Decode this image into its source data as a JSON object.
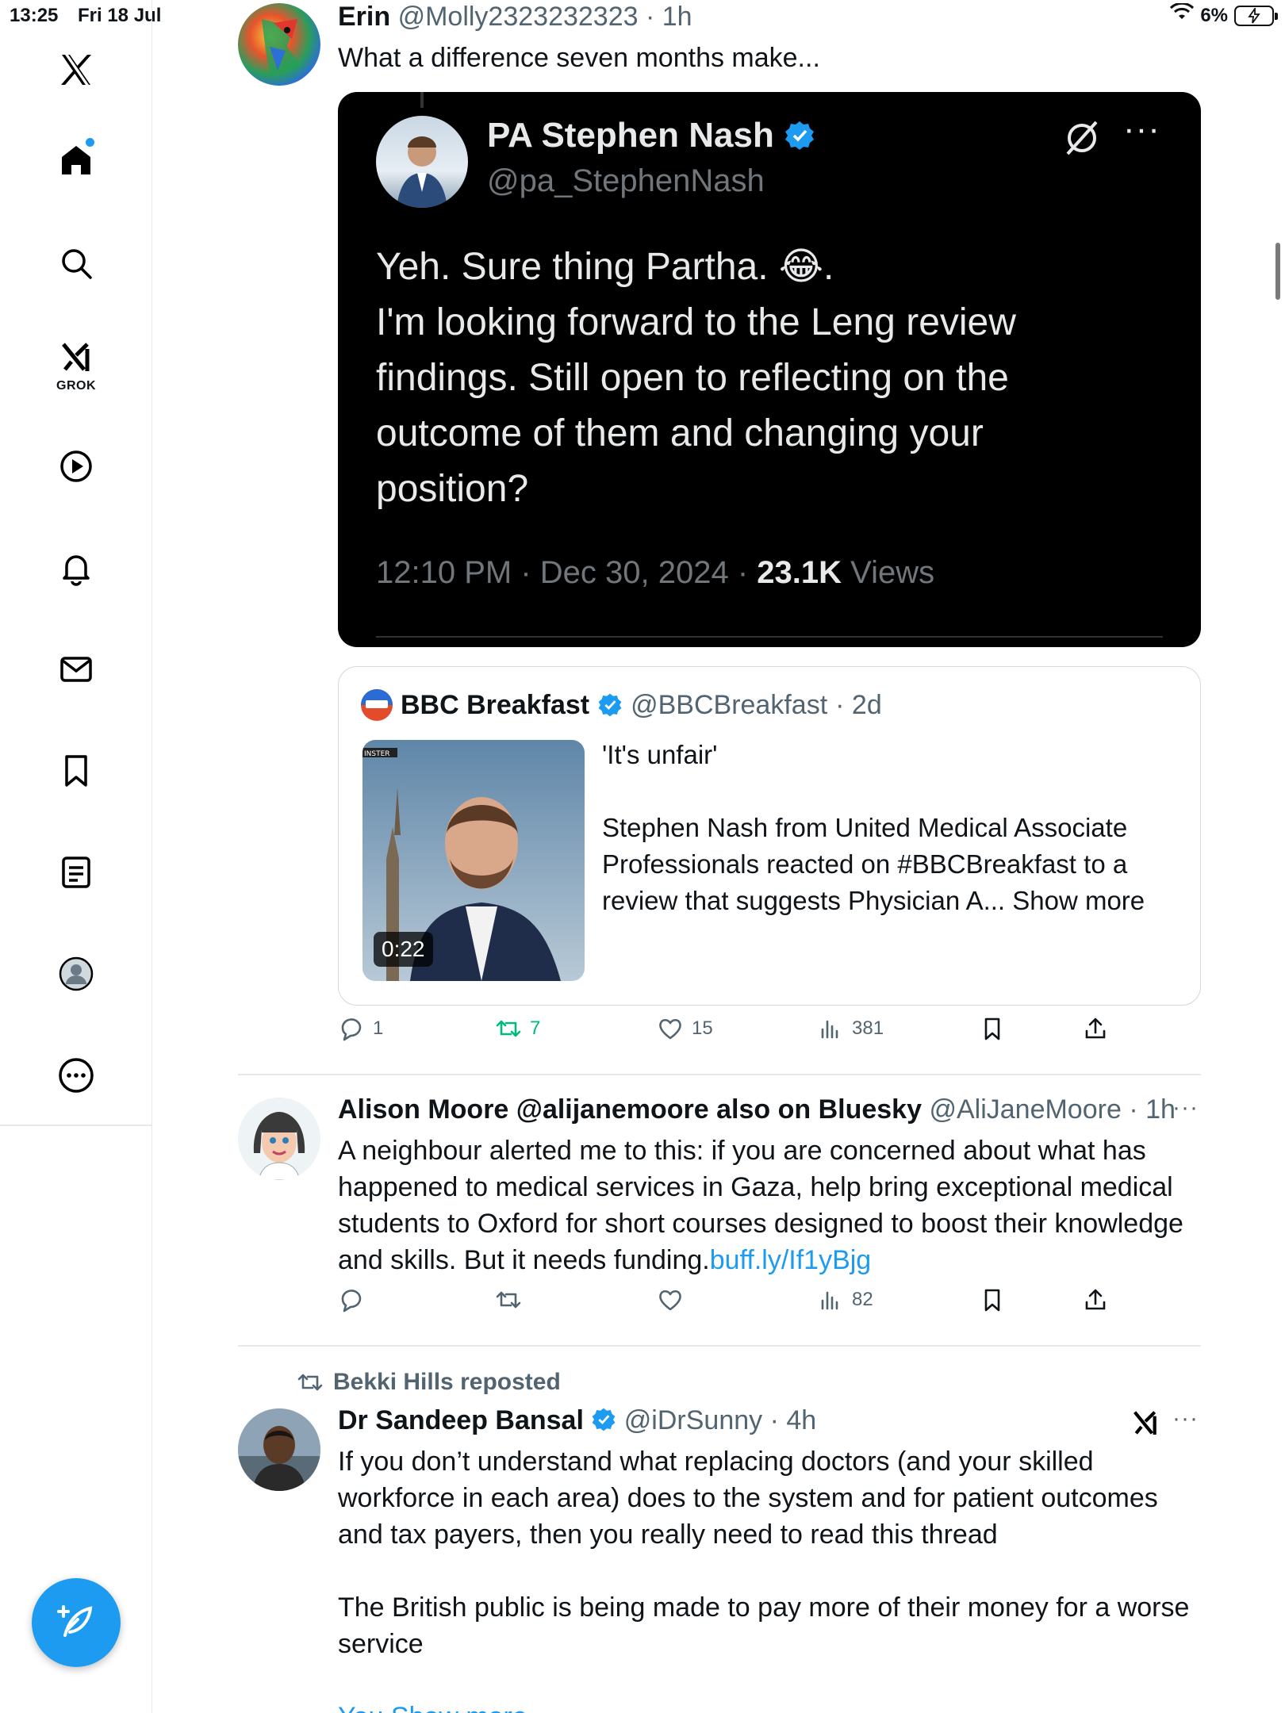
{
  "status_bar": {
    "time": "13:25",
    "date": "Fri 18 Jul",
    "battery": "6%"
  },
  "sidebar": {
    "items": [
      "home",
      "search",
      "grok",
      "video",
      "notifications",
      "messages",
      "bookmarks",
      "lists",
      "profile",
      "more"
    ],
    "grok_label": "GROK"
  },
  "tweet1": {
    "name": "Erin",
    "handle": "@Molly2323232323",
    "time": "1h",
    "text": "What a difference seven months make...",
    "embedded": {
      "name": "PA Stephen Nash",
      "handle": "@pa_StephenNash",
      "body_line1": "Yeh. Sure thing Partha. 😂.",
      "body_rest": "I'm looking forward to the Leng review findings. Still open to reflecting on the outcome of them and changing your position?",
      "timestamp": "12:10 PM · Dec 30, 2024 ·",
      "views_count": "23.1K",
      "views_label": "Views"
    },
    "quote": {
      "name": "BBC Breakfast",
      "handle": "@BBCBreakfast",
      "time": "· 2d",
      "line1": "'It's unfair'",
      "body": "Stephen Nash from United Medical Associate Professionals reacted on #BBCBreakfast to a review that suggests Physician A... Show more",
      "duration": "0:22"
    },
    "actions": {
      "replies": "1",
      "reposts": "7",
      "likes": "15",
      "views": "381"
    }
  },
  "tweet2": {
    "name": "Alison Moore @alijanemoore also on Bluesky",
    "handle": "@AliJaneMoore",
    "time": "· 1h",
    "text": "A neighbour alerted me to this: if you are concerned about what has happened to medical services in Gaza, help bring exceptional medical students to Oxford for short courses designed to boost their knowledge and skills. But it needs funding.",
    "link": "buff.ly/If1yBjg",
    "actions": {
      "replies": "",
      "reposts": "",
      "likes": "",
      "views": "82"
    }
  },
  "tweet3": {
    "repost_label": "Bekki Hills reposted",
    "name": "Dr Sandeep Bansal",
    "handle": "@iDrSunny",
    "time": "· 4h",
    "text1": "If you don’t understand what replacing doctors (and your skilled workforce in each area) does to the system and for patient outcomes and tax payers, then you really need to read this thread",
    "text2": "The British public is being made to pay more of their money for a worse service",
    "partial": "You Show more"
  },
  "colors": {
    "accent": "#1d9bf0",
    "repost_green": "#00ba7c",
    "text": "#0f1419",
    "muted": "#536471"
  }
}
